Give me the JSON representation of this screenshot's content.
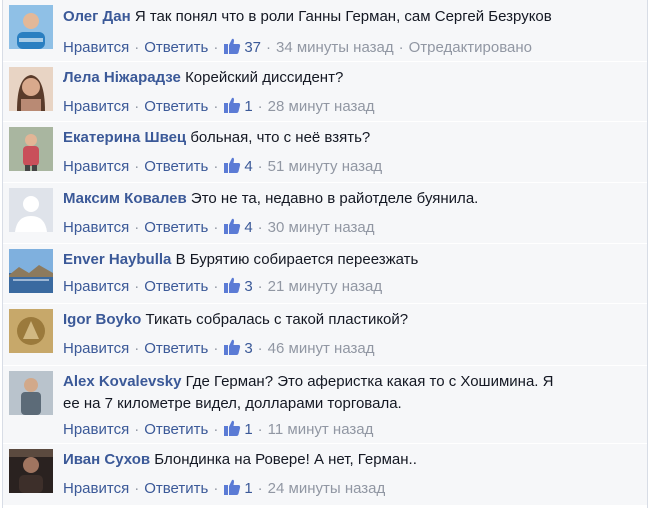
{
  "actions": {
    "like_label": "Нравится",
    "reply_label": "Ответить",
    "separator": "·"
  },
  "comments": [
    {
      "author": "Олег Дан",
      "text": "Я так понял что в роли Ганны Герман, сам Сергей Безруков",
      "likes": "37",
      "time": "34 минуты назад",
      "edited": "Отредактировано",
      "avatar_color": "#2a7fc1"
    },
    {
      "author": "Лела Ніжарадзе",
      "text": "Корейский диссидент?",
      "likes": "1",
      "time": "28 минут назад",
      "avatar_color": "#b98a74"
    },
    {
      "author": "Екатерина Швец",
      "text": "больная, что с неё взять?",
      "likes": "4",
      "time": "51 минуту назад",
      "avatar_color": "#c94f5a"
    },
    {
      "author": "Максим Ковалев",
      "text": "Это не та, недавно в райотделе буянила.",
      "likes": "4",
      "time": "30 минут назад",
      "avatar_color": "#d9dce1"
    },
    {
      "author": "Enver Haybulla",
      "text": "В Бурятию собирается переезжать",
      "likes": "3",
      "time": "21 минуту назад",
      "avatar_color": "#3a6aa0"
    },
    {
      "author": "Igor Boyko",
      "text": "Тикать собралась с такой пластикой?",
      "likes": "3",
      "time": "46 минут назад",
      "avatar_color": "#9b7a3c"
    },
    {
      "author": "Alex Kovalevsky",
      "text_line1": "Где Герман? Это аферистка какая то с Хошимина. Я",
      "text_line2": "ее на 7 километре видел, долларами торговала.",
      "likes": "1",
      "time": "11 минут назад",
      "avatar_color": "#5c6b78"
    },
    {
      "author": "Иван Сухов",
      "text": "Блондинка на Ровере! А нет, Герман..",
      "likes": "1",
      "time": "24 минуты назад",
      "avatar_color": "#3d2f2a"
    }
  ]
}
